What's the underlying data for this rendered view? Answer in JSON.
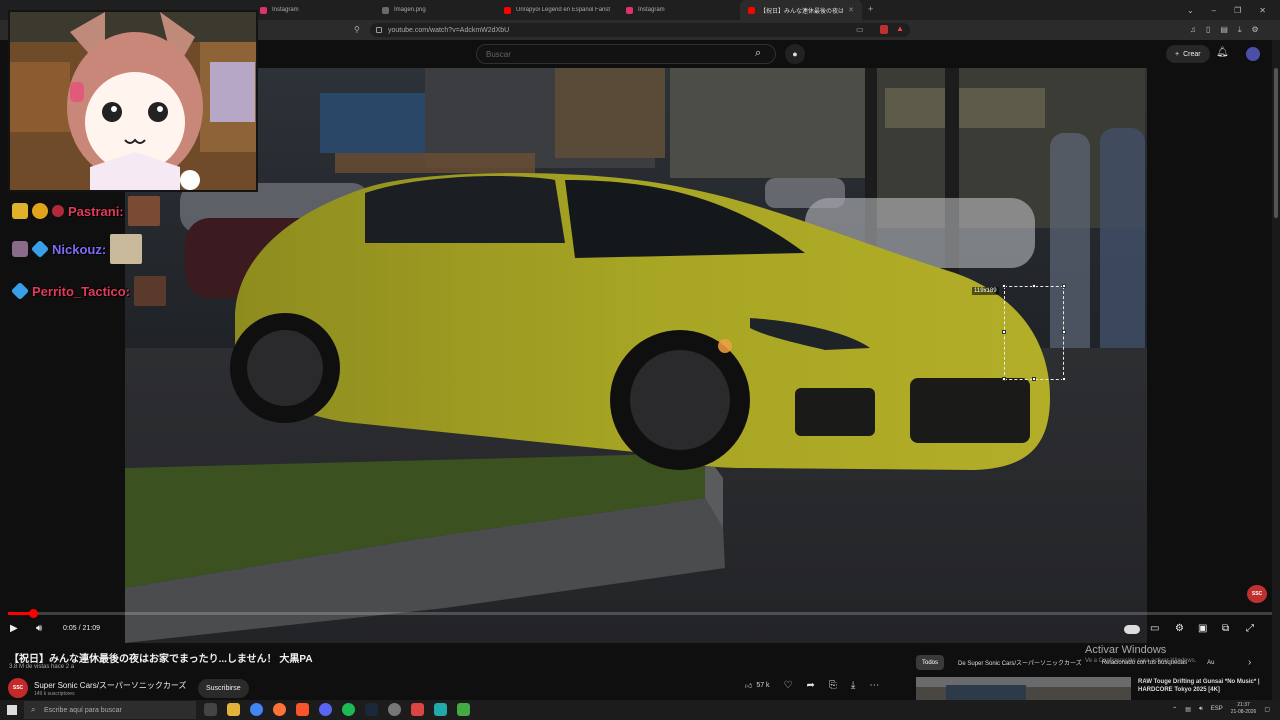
{
  "browser": {
    "tabs": [
      {
        "label": "Instagram",
        "color": "#e1306c"
      },
      {
        "label": "Imagen.png",
        "color": "#6a6a6a"
      },
      {
        "label": "Unrapyoi Legend en Español Fanst...",
        "color": "#ff0000"
      },
      {
        "label": "Instagram",
        "color": "#e1306c"
      },
      {
        "label": "【祝日】みんな連休最後の夜はお家...",
        "color": "#ff0000"
      }
    ],
    "url": "youtube.com/watch?v=AdckmW2dXbU"
  },
  "header": {
    "search_placeholder": "Buscar",
    "create_label": "Crear"
  },
  "overlay": {
    "chat": [
      {
        "name": "Pastrani:",
        "color": "#e23a58"
      },
      {
        "name": "Nickouz:",
        "color": "#7d6cf7"
      },
      {
        "name": "Perrito_Tactico:",
        "color": "#e23a58"
      }
    ],
    "selection_size": "119x189"
  },
  "player": {
    "time": "0:05 / 21:09",
    "progress": 0.004
  },
  "video": {
    "title": "【祝日】みんな連休最後の夜はお家でまったり...しません！ 大黒PA",
    "meta": "3.8 M de vistas  hace 2 a",
    "channel": "Super Sonic Cars/スーパーソニックカーズ",
    "channel_short": "SSC",
    "subscribers": "149 k suscriptores",
    "subscribe_label": "Suscribirse",
    "likes": "57 k"
  },
  "watermark": "SSC",
  "sidebar": {
    "chips": [
      "Todos",
      "De Super Sonic Cars/スーパーソニックカーズ",
      "Relacionado con tus búsquedas",
      "Au"
    ],
    "rec_title": "RAW Touge Drifting at Gunsai *No Music* | HARDCORE Tokyo 2025 [4K]"
  },
  "windows": {
    "activate": "Activar Windows",
    "activate_sub": "Ve a Configuración para activar Windows.",
    "search_placeholder": "Escribe aquí para buscar",
    "lang": "ESP",
    "time": "21:37",
    "date": "21-08-2026"
  }
}
